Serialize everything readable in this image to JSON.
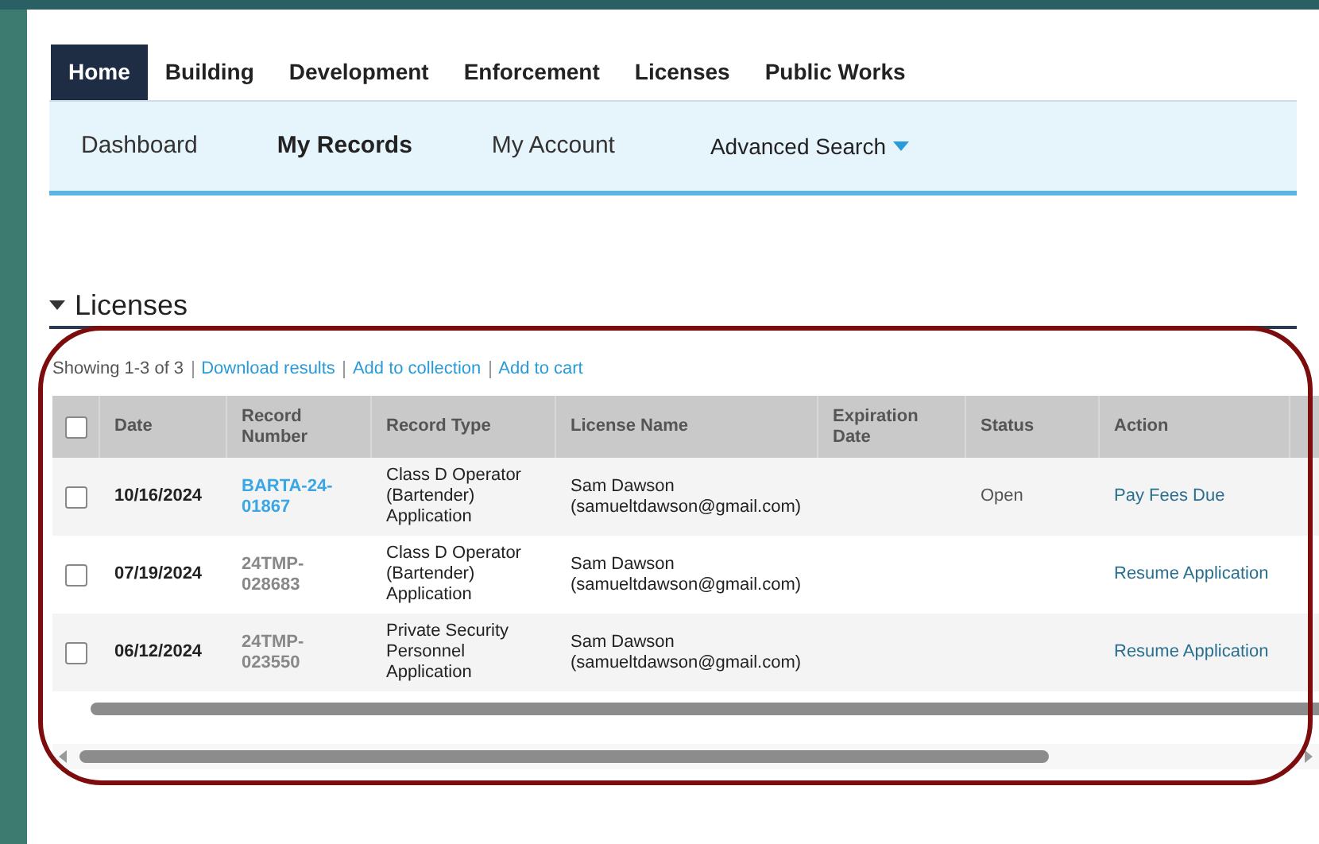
{
  "top_nav": [
    {
      "label": "Home",
      "selected": true
    },
    {
      "label": "Building",
      "selected": false
    },
    {
      "label": "Development",
      "selected": false
    },
    {
      "label": "Enforcement",
      "selected": false
    },
    {
      "label": "Licenses",
      "selected": false
    },
    {
      "label": "Public Works",
      "selected": false
    }
  ],
  "sub_nav": [
    {
      "label": "Dashboard",
      "selected": false,
      "kind": "link"
    },
    {
      "label": "My Records",
      "selected": true,
      "kind": "link"
    },
    {
      "label": "My Account",
      "selected": false,
      "kind": "link"
    },
    {
      "label": "Advanced Search",
      "selected": false,
      "kind": "dropdown"
    }
  ],
  "section": {
    "title": "Licenses",
    "expanded": true
  },
  "summary": "Showing 1-3 of 3",
  "result_links": [
    "Download results",
    "Add to collection",
    "Add to cart"
  ],
  "table": {
    "select_all": {
      "checked": false
    },
    "columns": [
      "Date",
      "Record Number",
      "Record Type",
      "License Name",
      "Expiration Date",
      "Status",
      "Action"
    ],
    "rows": [
      {
        "checked": false,
        "date": "10/16/2024",
        "record_number": "BARTA-24-01867",
        "linked": true,
        "record_type": "Class D Operator (Bartender) Application",
        "license_name": "Sam Dawson (samueltdawson@gmail.com)",
        "expiration_date": "",
        "status": "Open",
        "action": "Pay Fees Due"
      },
      {
        "checked": false,
        "date": "07/19/2024",
        "record_number": "24TMP-028683",
        "linked": false,
        "record_type": "Class D Operator (Bartender) Application",
        "license_name": "Sam Dawson (samueltdawson@gmail.com)",
        "expiration_date": "",
        "status": "",
        "action": "Resume Application"
      },
      {
        "checked": false,
        "date": "06/12/2024",
        "record_number": "24TMP-023550",
        "linked": false,
        "record_type": "Private Security Personnel Application",
        "license_name": "Sam Dawson (samueltdawson@gmail.com)",
        "expiration_date": "",
        "status": "",
        "action": "Resume Application"
      }
    ]
  }
}
